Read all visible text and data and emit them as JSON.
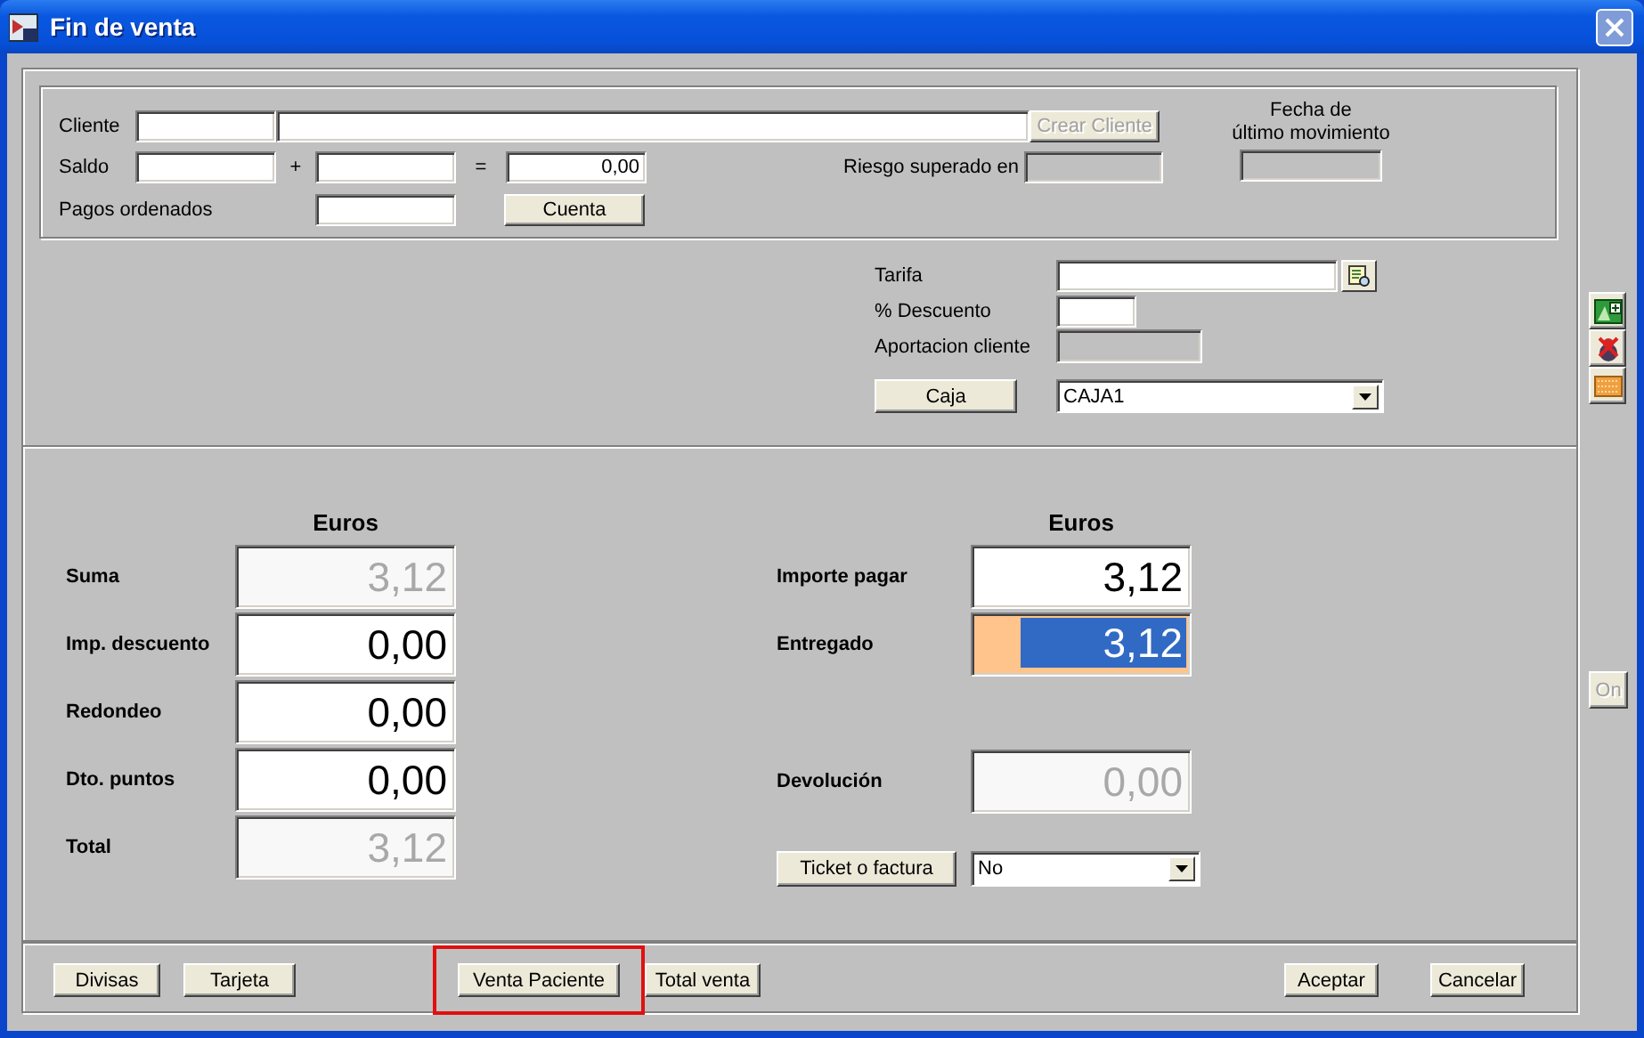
{
  "window": {
    "title": "Fin de venta"
  },
  "cliente": {
    "label": "Cliente",
    "create_button": {
      "label": "Crear Cliente",
      "disabled": true
    }
  },
  "saldo": {
    "label": "Saldo",
    "plus": "+",
    "equals": "=",
    "total": "0,00"
  },
  "pagos_ordenados": {
    "label": "Pagos ordenados",
    "button": "Cuenta"
  },
  "riesgo": {
    "label": "Riesgo superado en",
    "disabled": true
  },
  "fecha": {
    "label": "Fecha de\núltimo movimiento",
    "disabled": true
  },
  "tarifa": {
    "label": "Tarifa"
  },
  "descuento": {
    "label": "% Descuento"
  },
  "aportacion": {
    "label": "Aportacion cliente",
    "disabled": true
  },
  "caja": {
    "button": "Caja",
    "value": "CAJA1"
  },
  "sumas": {
    "heading": "Euros",
    "rows": [
      {
        "label": "Suma",
        "value": "3,12",
        "disabled": true
      },
      {
        "label": "Imp. descuento",
        "value": "0,00",
        "disabled": false
      },
      {
        "label": "Redondeo",
        "value": "0,00",
        "disabled": false
      },
      {
        "label": "Dto. puntos",
        "value": "0,00",
        "disabled": false
      },
      {
        "label": "Total",
        "value": "3,12",
        "disabled": true
      }
    ]
  },
  "pago": {
    "heading": "Euros",
    "rows": [
      {
        "label": "Importe pagar",
        "value": "3,12",
        "focused": false
      },
      {
        "label": "Entregado",
        "value": "3,12",
        "focused": true
      }
    ]
  },
  "devolucion": {
    "label": "Devolución",
    "value": "0,00",
    "disabled": true
  },
  "ticket": {
    "button": "Ticket o factura",
    "value": "No"
  },
  "side_buttons": [
    {
      "kind": "sheet"
    },
    {
      "kind": "bug"
    },
    {
      "kind": "strip"
    }
  ],
  "on_button": {
    "label": "On",
    "disabled": true
  },
  "footer_left_buttons": [
    {
      "label": "Divisas",
      "highlighted": false
    },
    {
      "label": "Tarjeta",
      "highlighted": false
    },
    {
      "label": "Venta Paciente",
      "highlighted": true
    },
    {
      "label": "Total venta",
      "highlighted": false
    }
  ],
  "footer_right_buttons": [
    {
      "label": "Aceptar",
      "highlighted": false
    },
    {
      "label": "Cancelar",
      "highlighted": false
    }
  ]
}
